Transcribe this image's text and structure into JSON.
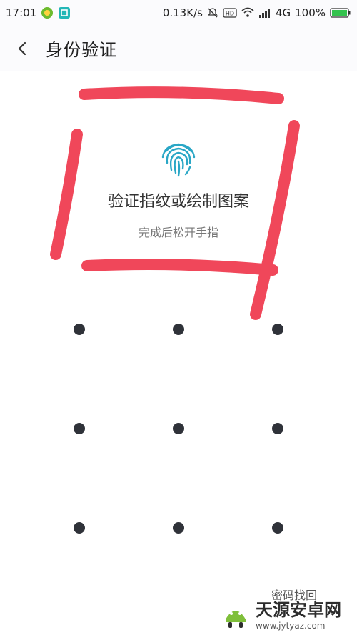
{
  "status_bar": {
    "time": "17:01",
    "net_speed": "0.13K/s",
    "network": "4G",
    "battery": "100%",
    "battery_level": 1.0,
    "icons": [
      "app-notification-icon",
      "scan-icon",
      "mute-bell-icon",
      "hd-icon",
      "wifi-icon",
      "signal-icon",
      "battery-icon"
    ]
  },
  "header": {
    "title": "身份验证",
    "back_icon": "chevron-left-icon"
  },
  "verify": {
    "fingerprint_icon": "fingerprint-icon",
    "fingerprint_color": "#2aa7c6",
    "headline": "验证指纹或绘制图案",
    "subline": "完成后松开手指"
  },
  "pattern": {
    "rows": 3,
    "cols": 3,
    "dot_color": "#2f3239"
  },
  "footer": {
    "forgot_label": "密码找回"
  },
  "annotation": {
    "color": "#f0475a"
  },
  "watermark": {
    "name": "天源安卓网",
    "url": "www.jytyaz.com"
  }
}
